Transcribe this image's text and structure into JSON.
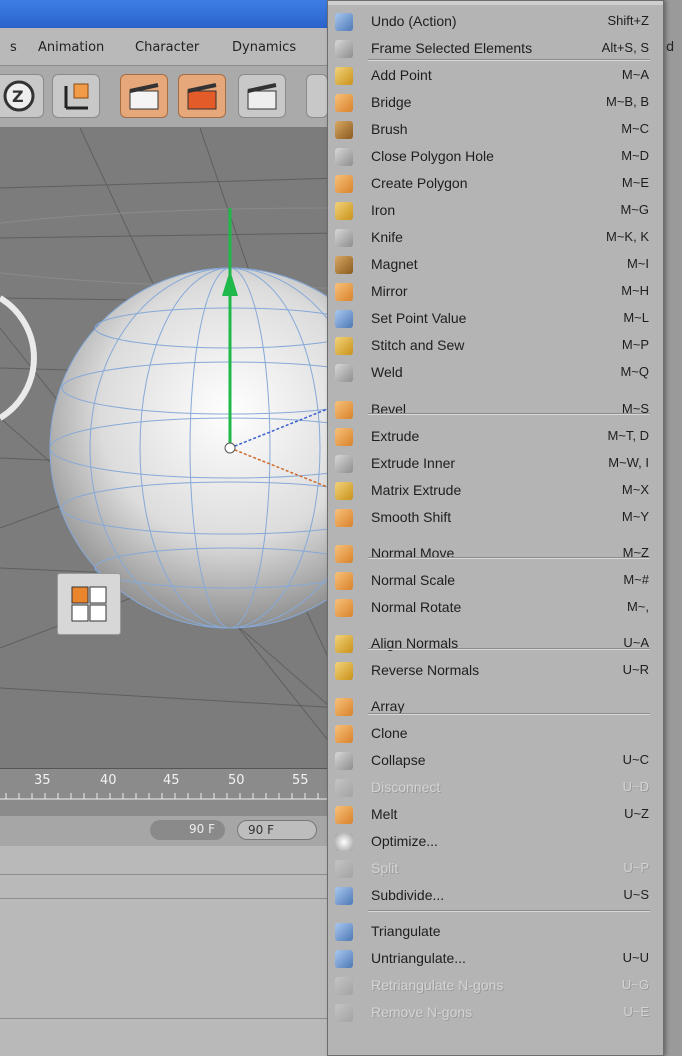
{
  "menubar": {
    "items": [
      "s",
      "Animation",
      "Character",
      "Dynamics"
    ],
    "edge_text": "d"
  },
  "timeline": {
    "ruler": [
      "35",
      "40",
      "45",
      "50",
      "55"
    ],
    "frame_a": "90 F",
    "frame_b": "90 F"
  },
  "colors": {
    "accent_orange": "#e6a77a",
    "menu_bg": "#b4b4b4",
    "viewport_bg": "#7c7c7c",
    "axis_green": "#1fb84a"
  },
  "menu": {
    "items": [
      {
        "label": "Undo (Action)",
        "shortcut": "Shift+Z",
        "icon": "undo-icon",
        "enabled": true
      },
      {
        "label": "Frame Selected Elements",
        "shortcut": "Alt+S, S",
        "icon": "frame-icon",
        "enabled": true
      },
      {
        "label": "Add Point",
        "shortcut": "M~A",
        "icon": "add-point-icon",
        "enabled": true
      },
      {
        "label": "Bridge",
        "shortcut": "M~B, B",
        "icon": "bridge-icon",
        "enabled": true
      },
      {
        "label": "Brush",
        "shortcut": "M~C",
        "icon": "brush-icon",
        "enabled": true
      },
      {
        "label": "Close Polygon Hole",
        "shortcut": "M~D",
        "icon": "close-hole-icon",
        "enabled": true
      },
      {
        "label": "Create Polygon",
        "shortcut": "M~E",
        "icon": "create-polygon-icon",
        "enabled": true
      },
      {
        "label": "Iron",
        "shortcut": "M~G",
        "icon": "iron-icon",
        "enabled": true
      },
      {
        "label": "Knife",
        "shortcut": "M~K, K",
        "icon": "knife-icon",
        "enabled": true
      },
      {
        "label": "Magnet",
        "shortcut": "M~I",
        "icon": "magnet-icon",
        "enabled": true
      },
      {
        "label": "Mirror",
        "shortcut": "M~H",
        "icon": "mirror-icon",
        "enabled": true
      },
      {
        "label": "Set Point Value",
        "shortcut": "M~L",
        "icon": "set-point-icon",
        "enabled": true
      },
      {
        "label": "Stitch and Sew",
        "shortcut": "M~P",
        "icon": "stitch-icon",
        "enabled": true
      },
      {
        "label": "Weld",
        "shortcut": "M~Q",
        "icon": "weld-icon",
        "enabled": true
      },
      {
        "label": "Bevel",
        "shortcut": "M~S",
        "icon": "bevel-icon",
        "enabled": true
      },
      {
        "label": "Extrude",
        "shortcut": "M~T, D",
        "icon": "extrude-icon",
        "enabled": true
      },
      {
        "label": "Extrude Inner",
        "shortcut": "M~W, I",
        "icon": "extrude-inner-icon",
        "enabled": true
      },
      {
        "label": "Matrix Extrude",
        "shortcut": "M~X",
        "icon": "matrix-extrude-icon",
        "enabled": true
      },
      {
        "label": "Smooth Shift",
        "shortcut": "M~Y",
        "icon": "smooth-shift-icon",
        "enabled": true
      },
      {
        "label": "Normal Move",
        "shortcut": "M~Z",
        "icon": "normal-move-icon",
        "enabled": true
      },
      {
        "label": "Normal Scale",
        "shortcut": "M~#",
        "icon": "normal-scale-icon",
        "enabled": true
      },
      {
        "label": "Normal Rotate",
        "shortcut": "M~,",
        "icon": "normal-rotate-icon",
        "enabled": true
      },
      {
        "label": "Align Normals",
        "shortcut": "U~A",
        "icon": "align-normals-icon",
        "enabled": true
      },
      {
        "label": "Reverse Normals",
        "shortcut": "U~R",
        "icon": "reverse-normals-icon",
        "enabled": true
      },
      {
        "label": "Array",
        "shortcut": "",
        "icon": "array-icon",
        "enabled": true
      },
      {
        "label": "Clone",
        "shortcut": "",
        "icon": "clone-icon",
        "enabled": true
      },
      {
        "label": "Collapse",
        "shortcut": "U~C",
        "icon": "collapse-icon",
        "enabled": true
      },
      {
        "label": "Disconnect",
        "shortcut": "U~D",
        "icon": "disconnect-icon",
        "enabled": false
      },
      {
        "label": "Melt",
        "shortcut": "U~Z",
        "icon": "melt-icon",
        "enabled": true
      },
      {
        "label": "Optimize...",
        "shortcut": "",
        "icon": "optimize-icon",
        "enabled": true
      },
      {
        "label": "Split",
        "shortcut": "U~P",
        "icon": "split-icon",
        "enabled": false
      },
      {
        "label": "Subdivide...",
        "shortcut": "U~S",
        "icon": "subdivide-icon",
        "enabled": true
      },
      {
        "label": "Triangulate",
        "shortcut": "",
        "icon": "triangulate-icon",
        "enabled": true
      },
      {
        "label": "Untriangulate...",
        "shortcut": "U~U",
        "icon": "untriangulate-icon",
        "enabled": true
      },
      {
        "label": "Retriangulate N-gons",
        "shortcut": "U~G",
        "icon": "retriangulate-icon",
        "enabled": false
      },
      {
        "label": "Remove N-gons",
        "shortcut": "U~E",
        "icon": "remove-ngons-icon",
        "enabled": false
      }
    ]
  }
}
